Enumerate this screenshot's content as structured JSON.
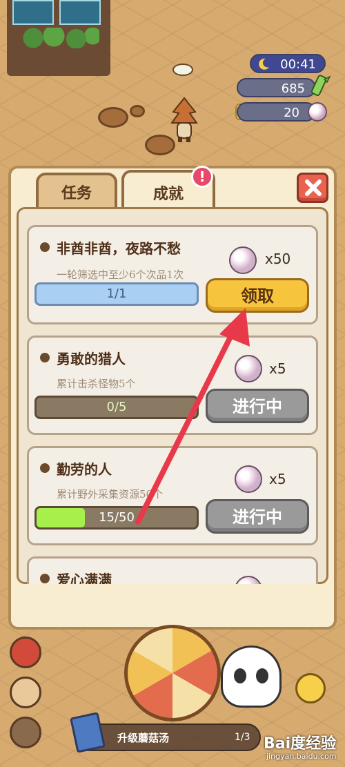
{
  "hud": {
    "time": "00:41",
    "coins": "685",
    "pearls": "20"
  },
  "tabs": [
    {
      "label": "任务",
      "active": false
    },
    {
      "label": "成就",
      "active": true,
      "badge": "!"
    }
  ],
  "achievements": [
    {
      "title": "非酋非酋，夜路不愁",
      "desc": "一轮筛选中至少6个次品1次",
      "reward": "x50",
      "progress_text": "1/1",
      "progress": 1.0,
      "button": "领取",
      "state": "claim"
    },
    {
      "title": "勇敢的猎人",
      "desc": "累计击杀怪物5个",
      "reward": "x5",
      "progress_text": "0/5",
      "progress": 0.0,
      "button": "进行中",
      "state": "in-progress"
    },
    {
      "title": "勤劳的人",
      "desc": "累计野外采集资源50个",
      "reward": "x5",
      "progress_text": "15/50",
      "progress": 0.3,
      "button": "进行中",
      "state": "in-progress"
    },
    {
      "title": "爱心满满"
    }
  ],
  "bottom": {
    "quest_text": "升级蘑菇汤",
    "quest_count": "1/3"
  },
  "watermark": {
    "main": "Bai度经验",
    "sub": "jingyan.baidu.com"
  },
  "colors": {
    "claim_button": "#f7c43e",
    "progress_button": "#9a9a9a",
    "bar_complete": "#a9d0f3",
    "bar_partial": "#a7f04c",
    "badge": "#e64a6a",
    "arrow": "#e8394a"
  }
}
